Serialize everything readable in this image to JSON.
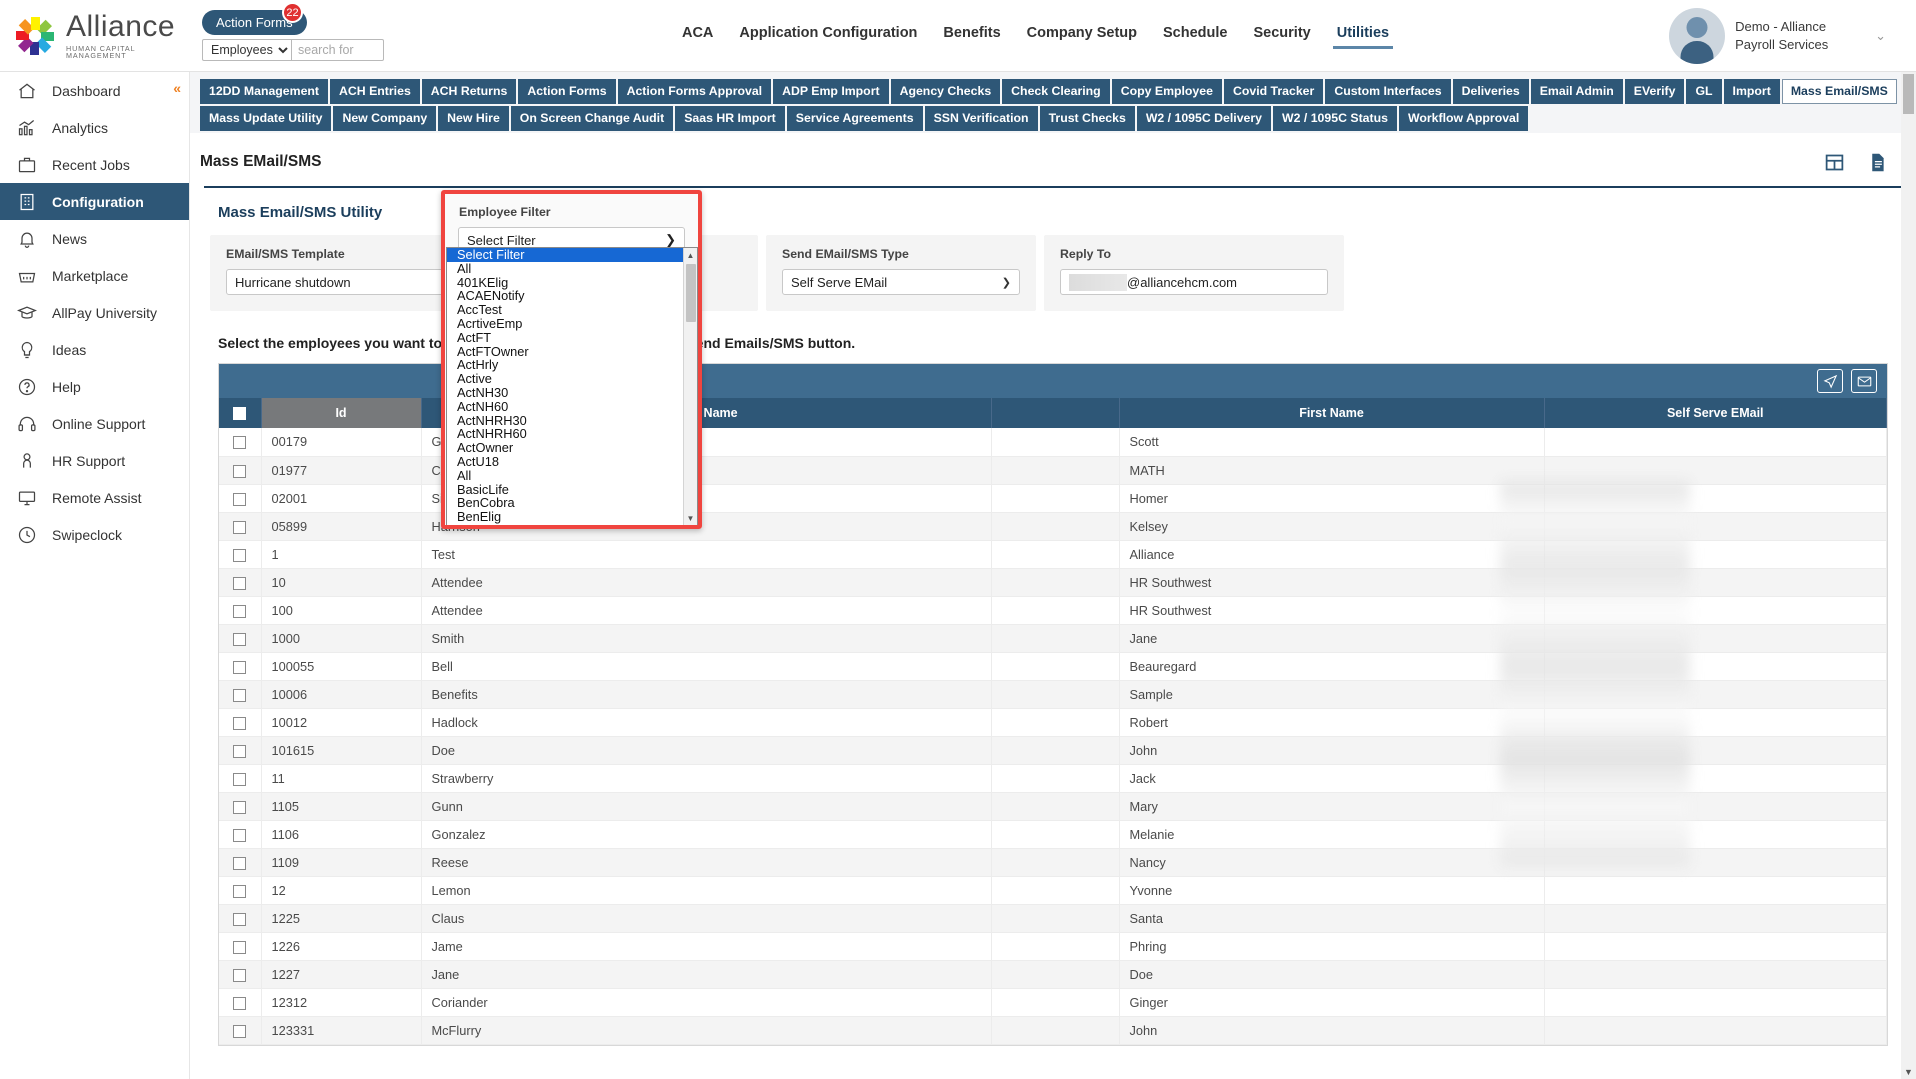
{
  "header": {
    "logo_name": "Alliance",
    "logo_sub": "HUMAN CAPITAL MANAGEMENT",
    "action_forms_label": "Action Forms",
    "action_forms_badge": "22",
    "search_scope": "Employees",
    "search_placeholder": "search for",
    "menu": [
      {
        "label": "ACA",
        "active": false
      },
      {
        "label": "Application Configuration",
        "active": false
      },
      {
        "label": "Benefits",
        "active": false
      },
      {
        "label": "Company Setup",
        "active": false
      },
      {
        "label": "Schedule",
        "active": false
      },
      {
        "label": "Security",
        "active": false
      },
      {
        "label": "Utilities",
        "active": true
      }
    ],
    "user_name": "Demo - Alliance Payroll Services"
  },
  "sidebar": {
    "items": [
      {
        "label": "Dashboard",
        "icon": "home-icon",
        "active": false
      },
      {
        "label": "Analytics",
        "icon": "analytics-icon",
        "active": false
      },
      {
        "label": "Recent Jobs",
        "icon": "briefcase-icon",
        "active": false
      },
      {
        "label": "Configuration",
        "icon": "building-icon",
        "active": true
      },
      {
        "label": "News",
        "icon": "bell-icon",
        "active": false
      },
      {
        "label": "Marketplace",
        "icon": "basket-icon",
        "active": false
      },
      {
        "label": "AllPay University",
        "icon": "graduation-cap-icon",
        "active": false
      },
      {
        "label": "Ideas",
        "icon": "lightbulb-icon",
        "active": false
      },
      {
        "label": "Help",
        "icon": "question-circle-icon",
        "active": false
      },
      {
        "label": "Online Support",
        "icon": "headset-icon",
        "active": false
      },
      {
        "label": "HR Support",
        "icon": "person-icon",
        "active": false
      },
      {
        "label": "Remote Assist",
        "icon": "monitor-icon",
        "active": false
      },
      {
        "label": "Swipeclock",
        "icon": "clock-icon",
        "active": false
      }
    ]
  },
  "subtabs": {
    "row1": [
      {
        "label": "12DD Management",
        "selected": false
      },
      {
        "label": "ACH Entries",
        "selected": false
      },
      {
        "label": "ACH Returns",
        "selected": false
      },
      {
        "label": "Action Forms",
        "selected": false
      },
      {
        "label": "Action Forms Approval",
        "selected": false
      },
      {
        "label": "ADP Emp Import",
        "selected": false
      },
      {
        "label": "Agency Checks",
        "selected": false
      },
      {
        "label": "Check Clearing",
        "selected": false
      },
      {
        "label": "Copy Employee",
        "selected": false
      },
      {
        "label": "Covid Tracker",
        "selected": false
      },
      {
        "label": "Custom Interfaces",
        "selected": false
      },
      {
        "label": "Deliveries",
        "selected": false
      },
      {
        "label": "Email Admin",
        "selected": false
      },
      {
        "label": "EVerify",
        "selected": false
      },
      {
        "label": "GL",
        "selected": false
      },
      {
        "label": "Import",
        "selected": false
      },
      {
        "label": "Mass Email/SMS",
        "selected": true
      }
    ],
    "row2": [
      {
        "label": "Mass Update Utility",
        "selected": false
      },
      {
        "label": "New Company",
        "selected": false
      },
      {
        "label": "New Hire",
        "selected": false
      },
      {
        "label": "On Screen Change Audit",
        "selected": false
      },
      {
        "label": "Saas HR Import",
        "selected": false
      },
      {
        "label": "Service Agreements",
        "selected": false
      },
      {
        "label": "SSN Verification",
        "selected": false
      },
      {
        "label": "Trust Checks",
        "selected": false
      },
      {
        "label": "W2 / 1095C Delivery",
        "selected": false
      },
      {
        "label": "W2 / 1095C Status",
        "selected": false
      },
      {
        "label": "Workflow Approval",
        "selected": false
      }
    ]
  },
  "page": {
    "title": "Mass EMail/SMS",
    "panel_title": "Mass Email/SMS Utility",
    "instruction": "Select the employees you want to send Emails/SMS to, then press the Send Emails/SMS button.",
    "icons": {
      "grid": "table-grid-icon",
      "doc": "document-icon"
    }
  },
  "filters": {
    "template": {
      "label": "EMail/SMS Template",
      "value": "Hurricane shutdown"
    },
    "employee_filter": {
      "label": "Employee Filter",
      "value": "Select Filter"
    },
    "send_type": {
      "label": "Send EMail/SMS Type",
      "value": "Self Serve EMail"
    },
    "reply_to": {
      "label": "Reply To",
      "value": "@alliancehcm.com",
      "redacted": true
    }
  },
  "employee_filter_options": [
    "Select Filter",
    "All",
    "401KElig",
    "ACAENotify",
    "AccTest",
    "AcrtiveEmp",
    "ActFT",
    "ActFTOwner",
    "ActHrly",
    "Active",
    "ActNH30",
    "ActNH60",
    "ActNHRH30",
    "ActNHRH60",
    "ActOwner",
    "ActU18",
    "All",
    "BasicLife",
    "BenCobra",
    "BenElig"
  ],
  "grid": {
    "toolbar": {
      "send_icon": "send-plane-icon",
      "mail_icon": "envelope-icon"
    },
    "columns": [
      "",
      "Id",
      "Last Name",
      "",
      "First Name",
      "Self Serve EMail"
    ],
    "rows": [
      {
        "id": "00179",
        "last": "Gray",
        "first": "Scott",
        "email": ""
      },
      {
        "id": "01977",
        "last": "CALC",
        "first": "MATH",
        "email": ""
      },
      {
        "id": "02001",
        "last": "Simpson",
        "first": "Homer",
        "email": ""
      },
      {
        "id": "05899",
        "last": "Harrison",
        "first": "Kelsey",
        "email": ""
      },
      {
        "id": "1",
        "last": "Test",
        "first": "Alliance",
        "email": ""
      },
      {
        "id": "10",
        "last": "Attendee",
        "first": "HR Southwest",
        "email": ""
      },
      {
        "id": "100",
        "last": "Attendee",
        "first": "HR Southwest",
        "email": ""
      },
      {
        "id": "1000",
        "last": "Smith",
        "first": "Jane",
        "email": ""
      },
      {
        "id": "100055",
        "last": "Bell",
        "first": "Beauregard",
        "email": ""
      },
      {
        "id": "10006",
        "last": "Benefits",
        "first": "Sample",
        "email": ""
      },
      {
        "id": "10012",
        "last": "Hadlock",
        "first": "Robert",
        "email": ""
      },
      {
        "id": "101615",
        "last": "Doe",
        "first": "John",
        "email": ""
      },
      {
        "id": "11",
        "last": "Strawberry",
        "first": "Jack",
        "email": ""
      },
      {
        "id": "1105",
        "last": "Gunn",
        "first": "Mary",
        "email": ""
      },
      {
        "id": "1106",
        "last": "Gonzalez",
        "first": "Melanie",
        "email": ""
      },
      {
        "id": "1109",
        "last": "Reese",
        "first": "Nancy",
        "email": ""
      },
      {
        "id": "12",
        "last": "Lemon",
        "first": "Yvonne",
        "email": ""
      },
      {
        "id": "1225",
        "last": "Claus",
        "first": "Santa",
        "email": ""
      },
      {
        "id": "1226",
        "last": "Jame",
        "first": "Phring",
        "email": ""
      },
      {
        "id": "1227",
        "last": "Jane",
        "first": "Doe",
        "email": ""
      },
      {
        "id": "12312",
        "last": "Coriander",
        "first": "Ginger",
        "email": ""
      },
      {
        "id": "123331",
        "last": "McFlurry",
        "first": "John",
        "email": ""
      }
    ]
  },
  "colors": {
    "brand_dark": "#2e5777",
    "brand_mid": "#3f6c8f",
    "accent_orange": "#ef8122",
    "badge_red": "#e03030",
    "highlight_red": "#f0453f",
    "select_blue": "#1668d4"
  }
}
